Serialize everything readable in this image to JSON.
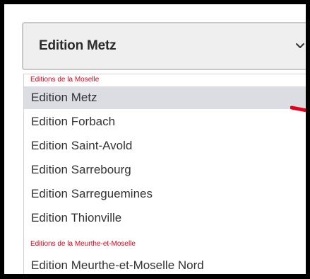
{
  "select": {
    "value": "Edition Metz",
    "icon": "chevron-down-icon"
  },
  "dropdown": {
    "groups": [
      {
        "label": "Editions de la Moselle",
        "options": [
          {
            "label": "Edition Metz",
            "selected": true
          },
          {
            "label": "Edition Forbach",
            "selected": false
          },
          {
            "label": "Edition Saint-Avold",
            "selected": false
          },
          {
            "label": "Edition Sarrebourg",
            "selected": false
          },
          {
            "label": "Edition Sarreguemines",
            "selected": false
          },
          {
            "label": "Edition Thionville",
            "selected": false
          }
        ]
      },
      {
        "label": "Editions de la Meurthe-et-Moselle",
        "options": [
          {
            "label": "Edition Meurthe-et-Moselle Nord",
            "selected": false
          }
        ]
      }
    ]
  },
  "colors": {
    "group_label": "#e2001a",
    "selected_background": "#dcdde3",
    "select_background": "#efefef",
    "annotation_arrow": "#e2001a"
  }
}
